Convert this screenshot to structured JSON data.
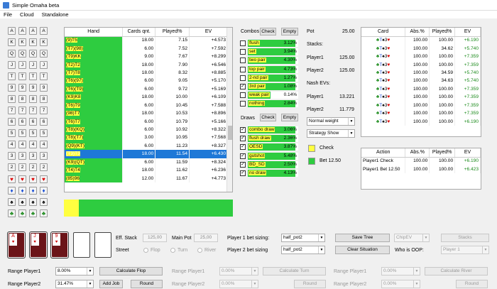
{
  "window": {
    "title": "Simple Omaha beta"
  },
  "menu": [
    "File",
    "Cloud",
    "Standalone"
  ],
  "ranks": [
    "A",
    "K",
    "Q",
    "J",
    "T",
    "9",
    "8",
    "7",
    "6",
    "5",
    "4",
    "3",
    "2"
  ],
  "suit_rows": [
    [
      "♥",
      "♥",
      "♥",
      "♥"
    ],
    [
      "♦",
      "♦",
      "♦",
      "♦"
    ],
    [
      "♠",
      "♠",
      "♠",
      "♠"
    ],
    [
      "♣",
      "♣",
      "♣",
      "♣"
    ]
  ],
  "hand_table": {
    "headers": [
      "Hand",
      "Cards qnt.",
      "Played%",
      "EV"
    ],
    "rows": [
      {
        "hand": "(9)T5",
        "qnt": "18.00",
        "played": "7.15",
        "ev": "+4.573"
      },
      {
        "hand": "(T7)(98)",
        "qnt": "6.00",
        "played": "7.52",
        "ev": "+7.592"
      },
      {
        "hand": "(T9)KK",
        "qnt": "9.00",
        "played": "7.67",
        "ev": "+8.299"
      },
      {
        "hand": "(T2)T2",
        "qnt": "18.00",
        "played": "7.90",
        "ev": "+6.546"
      },
      {
        "hand": "(T7)T8",
        "qnt": "18.00",
        "played": "8.32",
        "ev": "+8.885"
      },
      {
        "hand": "(T6)(97)",
        "qnt": "6.00",
        "played": "9.05",
        "ev": "+5.170"
      },
      {
        "hand": "(T6)(T9)",
        "qnt": "6.00",
        "played": "9.72",
        "ev": "+5.169"
      },
      {
        "hand": "(K9)K8",
        "qnt": "18.00",
        "played": "10.00",
        "ev": "+6.109"
      },
      {
        "hand": "(T6)T9",
        "qnt": "6.00",
        "played": "10.45",
        "ev": "+7.588"
      },
      {
        "hand": "(98)T7",
        "qnt": "18.00",
        "played": "10.53",
        "ev": "+8.896"
      },
      {
        "hand": "(T6)T7",
        "qnt": "6.00",
        "played": "10.79",
        "ev": "+5.166"
      },
      {
        "hand": "(T8)(KQ)",
        "qnt": "6.00",
        "played": "10.92",
        "ev": "+8.322"
      },
      {
        "hand": "(T8)(T7)",
        "qnt": "3.00",
        "played": "10.95",
        "ev": "+7.568"
      },
      {
        "hand": "(Q9)(KT)",
        "qnt": "6.00",
        "played": "11.23",
        "ev": "+8.327"
      },
      {
        "hand": "(T3)T3",
        "qnt": "18.00",
        "played": "11.54",
        "ev": "+6.430"
      },
      {
        "hand": "(K9)(QT)",
        "qnt": "6.00",
        "played": "11.59",
        "ev": "+8.324"
      },
      {
        "hand": "(T4)T4",
        "qnt": "18.00",
        "played": "11.62",
        "ev": "+6.236"
      },
      {
        "hand": "(85)96",
        "qnt": "12.00",
        "played": "11.67",
        "ev": "+4.773"
      }
    ],
    "selected_index": 14
  },
  "combos": {
    "label": "Combos",
    "check_label": "Check",
    "empty_label": "Empty",
    "items": [
      {
        "label": "flush",
        "pct": "3.12%",
        "fill": 0.95,
        "checked": false
      },
      {
        "label": "set",
        "pct": "3.94%",
        "fill": 0.95,
        "checked": false
      },
      {
        "label": "two pair",
        "pct": "4.30%",
        "fill": 0.95,
        "checked": false
      },
      {
        "label": "top pair",
        "pct": "4.73%",
        "fill": 0.95,
        "checked": false
      },
      {
        "label": "2-nd pair",
        "pct": "1.27%",
        "fill": 0.95,
        "checked": false
      },
      {
        "label": "3rd pair",
        "pct": "1.08%",
        "fill": 0.95,
        "checked": true
      },
      {
        "label": "weak pair",
        "pct": "0.14%",
        "fill": 0.45,
        "checked": false
      },
      {
        "label": "nothing",
        "pct": "2.84%",
        "fill": 0.95,
        "checked": false
      }
    ]
  },
  "draws": {
    "label": "Draws",
    "check_label": "Check",
    "empty_label": "Empty",
    "items": [
      {
        "label": "combo draw",
        "pct": "3.06%",
        "fill": 0.95,
        "checked": true
      },
      {
        "label": "flush draw",
        "pct": "2.36%",
        "fill": 0.95,
        "checked": true
      },
      {
        "label": "OESD",
        "pct": "3.87%",
        "fill": 0.95,
        "checked": true
      },
      {
        "label": "gutshot",
        "pct": "5.48%",
        "fill": 0.95,
        "checked": true
      },
      {
        "label": "BD_SD",
        "pct": "2.50%",
        "fill": 0.95,
        "checked": true
      },
      {
        "label": "no draw",
        "pct": "4.13%",
        "fill": 0.95,
        "checked": true
      }
    ]
  },
  "pot": {
    "label": "Pot",
    "value": "25.00",
    "stacks_label": "Stacks:",
    "p1_label": "Player1",
    "p1_stack": "125.00",
    "p2_label": "Player2",
    "p2_stack": "125.00",
    "nash_label": "Nash EVs:",
    "p1_ev": "13.221",
    "p2_ev": "11.779"
  },
  "dropdowns": {
    "weight": "Normal weight",
    "strategy": "Strategy Show"
  },
  "legend": [
    {
      "label": "Check",
      "color": "#ffff40"
    },
    {
      "label": "Bet 12.50",
      "color": "#2ecc40"
    }
  ],
  "card_table": {
    "headers": [
      "Card",
      "Abs.%",
      "Played%",
      "EV"
    ],
    "rows": [
      {
        "c": [
          "♣",
          "T",
          "♠",
          "3",
          "♥"
        ],
        "abs": "100.00",
        "played": "100.00",
        "ev": "+6.190"
      },
      {
        "c": [
          "♣",
          "T",
          "♠",
          "3",
          "♥"
        ],
        "abs": "100.00",
        "played": "34.62",
        "ev": "+5.740"
      },
      {
        "c": [
          "♣",
          "T",
          "♠",
          "3",
          "♥"
        ],
        "abs": "100.00",
        "played": "100.00",
        "ev": "+7.359"
      },
      {
        "c": [
          "♣",
          "T",
          "♠",
          "3",
          "♥"
        ],
        "abs": "100.00",
        "played": "100.00",
        "ev": "+7.359"
      },
      {
        "c": [
          "♣",
          "T",
          "♠",
          "3",
          "♥"
        ],
        "abs": "100.00",
        "played": "34.59",
        "ev": "+5.740"
      },
      {
        "c": [
          "♣",
          "T",
          "♠",
          "3",
          "♥"
        ],
        "abs": "100.00",
        "played": "34.63",
        "ev": "+5.740"
      },
      {
        "c": [
          "♣",
          "T",
          "♠",
          "3",
          "♥"
        ],
        "abs": "100.00",
        "played": "100.00",
        "ev": "+7.359"
      },
      {
        "c": [
          "♣",
          "T",
          "♠",
          "3",
          "♥"
        ],
        "abs": "100.00",
        "played": "100.00",
        "ev": "+7.359"
      },
      {
        "c": [
          "♣",
          "T",
          "♠",
          "3",
          "♥"
        ],
        "abs": "100.00",
        "played": "100.00",
        "ev": "+7.359"
      },
      {
        "c": [
          "♣",
          "T",
          "♠",
          "3",
          "♥"
        ],
        "abs": "100.00",
        "played": "100.00",
        "ev": "+7.359"
      },
      {
        "c": [
          "♣",
          "T",
          "♠",
          "3",
          "♥"
        ],
        "abs": "100.00",
        "played": "100.00",
        "ev": "+6.190"
      }
    ]
  },
  "action_table": {
    "headers": [
      "Action",
      "Abs.%",
      "Played%",
      "EV"
    ],
    "rows": [
      {
        "action": "Player1 Check",
        "abs": "100.00",
        "played": "100.00",
        "ev": "+6.190"
      },
      {
        "action": "Player1 Bet 12.50",
        "abs": "100.00",
        "played": "100.00",
        "ev": "+6.423"
      }
    ]
  },
  "board_cards": [
    {
      "rank": "A",
      "suit": "♥"
    },
    {
      "rank": "J",
      "suit": "♥"
    },
    {
      "rank": "9",
      "suit": "♥"
    }
  ],
  "summary_bar": {
    "check_fraction": 0.09,
    "colors": {
      "check": "#ffff40",
      "bet": "#2ecc40"
    }
  },
  "controls": {
    "eff_stack_label": "Eff. Stack",
    "eff_stack": "125,00",
    "main_pot_label": "Main Pot",
    "main_pot": "25,00",
    "street_label": "Street",
    "streets": [
      "Flop",
      "Turn",
      "River"
    ],
    "p1_sizing_label": "Player 1 bet sizing:",
    "p1_sizing": "half_pot2",
    "p2_sizing_label": "Player 2 bet sizing",
    "p2_sizing": "half_pot2",
    "save_tree": "Save Tree",
    "chip_ev": "ChipEV",
    "stacks": "Stacks",
    "clear_situation": "Clear Situation",
    "who_oop_label": "Who is OOP:",
    "who_oop": "Player 1"
  },
  "bottom": {
    "range_p1_label": "Range Player1",
    "range_p1": "8.00%",
    "calc_flop": "Calculate Flop",
    "range_p2_label": "Range Player2",
    "range_p2": "31.47%",
    "add_job": "Add Job",
    "round": "Round",
    "turn_p1_label": "Range Player1",
    "turn_p1": "0.00%",
    "calc_turn": "Calculate Turn",
    "turn_p2_label": "Range Player2",
    "turn_p2": "0.00%",
    "turn_round": "Round",
    "river_p1_label": "Range Player1",
    "river_p1": "0.00%",
    "calc_river": "Calculate River",
    "river_p2_label": "Range Player2",
    "river_p2": "0.00%",
    "river_round": "Round"
  }
}
